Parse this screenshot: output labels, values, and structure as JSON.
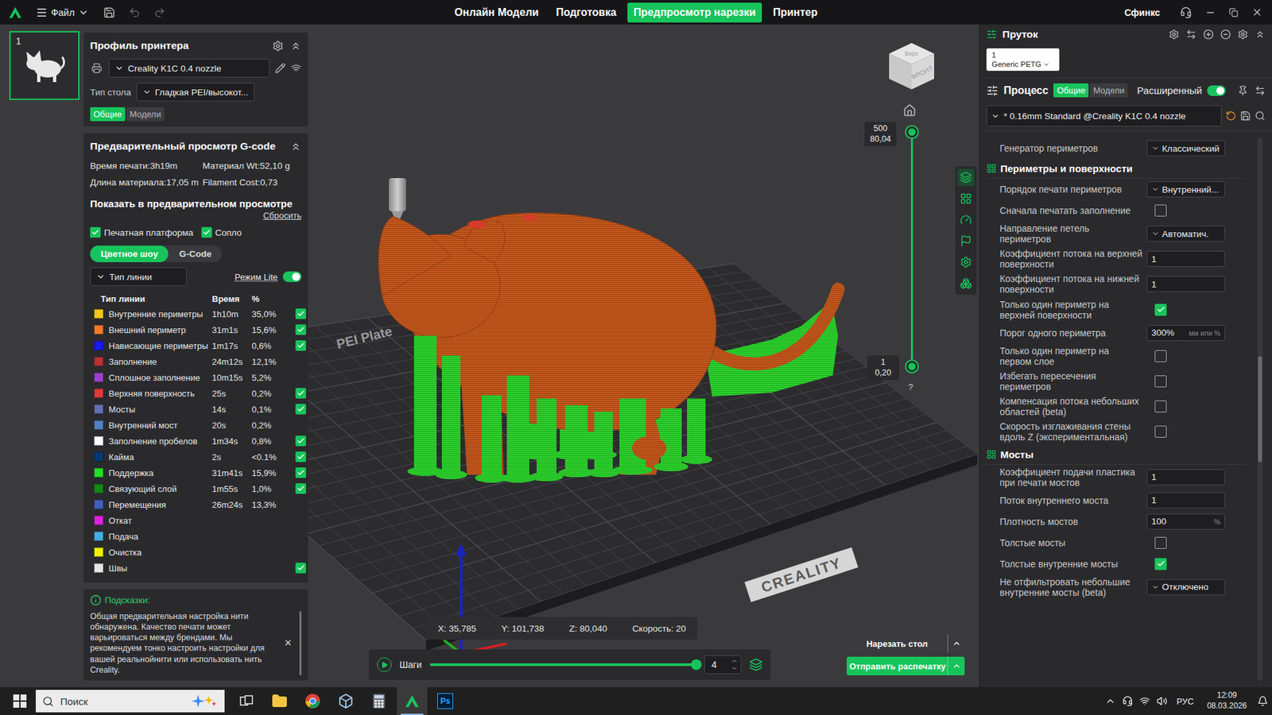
{
  "app": {
    "menu": "Файл",
    "user": "Сфинкс"
  },
  "topTabs": [
    {
      "label": "Онлайн Модели",
      "selected": false
    },
    {
      "label": "Подготовка",
      "selected": false
    },
    {
      "label": "Предпросмотр нарезки",
      "selected": true
    },
    {
      "label": "Принтер",
      "selected": false
    }
  ],
  "plates": [
    {
      "number": "1",
      "selected": true
    }
  ],
  "printerProfile": {
    "title": "Профиль принтера",
    "printer": "Creality K1C 0.4 nozzle",
    "bedLabel": "Тип стола",
    "bed": "Гладкая PEI/высокот...",
    "tabs": [
      {
        "label": "Общие",
        "selected": true
      },
      {
        "label": "Модели",
        "selected": false
      }
    ]
  },
  "gcodePreview": {
    "title": "Предварительный просмотр G-code",
    "stats": [
      "Время печати:3h19m",
      "Материал Wt:52,10 g",
      "Длина материала:17,05 m",
      "Filament Cost:0,73"
    ]
  },
  "display": {
    "title": "Показать в предварительном просмотре",
    "reset": "Сбросить",
    "options": [
      {
        "label": "Печатная платформа",
        "checked": true
      },
      {
        "label": "Сопло",
        "checked": true
      }
    ],
    "modes": [
      {
        "label": "Цветное шоу",
        "selected": true
      },
      {
        "label": "G-Code",
        "selected": false
      }
    ],
    "viewType": "Тип линии",
    "liteMode": {
      "label": "Режим Lite",
      "on": true
    },
    "columns": [
      "Тип линии",
      "Время",
      "%"
    ],
    "lines": [
      {
        "name": "Внутренние периметры",
        "time": "1h10m",
        "percent": "35,0%",
        "checked": true,
        "color": "#f5c518"
      },
      {
        "name": "Внешний периметр",
        "time": "31m1s",
        "percent": "15,6%",
        "checked": true,
        "color": "#f07a2a"
      },
      {
        "name": "Нависающие периметры",
        "time": "1m17s",
        "percent": "0,6%",
        "checked": true,
        "color": "#1a1aff"
      },
      {
        "name": "Заполнение",
        "time": "24m12s",
        "percent": "12,1%",
        "checked": false,
        "color": "#b83232"
      },
      {
        "name": "Сплошное заполнение",
        "time": "10m15s",
        "percent": "5,2%",
        "checked": false,
        "color": "#a040d0"
      },
      {
        "name": "Верхняя поверхность",
        "time": "25s",
        "percent": "0,2%",
        "checked": true,
        "color": "#e03a3a"
      },
      {
        "name": "Мосты",
        "time": "14s",
        "percent": "0,1%",
        "checked": true,
        "color": "#6070b0"
      },
      {
        "name": "Внутренний мост",
        "time": "20s",
        "percent": "0,2%",
        "checked": false,
        "color": "#4f82c4"
      },
      {
        "name": "Заполнение пробелов",
        "time": "1m34s",
        "percent": "0,8%",
        "checked": true,
        "color": "#ffffff"
      },
      {
        "name": "Кайма",
        "time": "2s",
        "percent": "<0.1%",
        "checked": true,
        "color": "#003a78"
      },
      {
        "name": "Поддержка",
        "time": "31m41s",
        "percent": "15,9%",
        "checked": true,
        "color": "#22e022"
      },
      {
        "name": "Связующий слой",
        "time": "1m55s",
        "percent": "1,0%",
        "checked": true,
        "color": "#108a10"
      },
      {
        "name": "Перемещения",
        "time": "26m24s",
        "percent": "13,3%",
        "checked": false,
        "color": "#4060c0"
      },
      {
        "name": "Откат",
        "time": "",
        "percent": "",
        "checked": false,
        "color": "#e020e0"
      },
      {
        "name": "Подача",
        "time": "",
        "percent": "",
        "checked": false,
        "color": "#40b0e0"
      },
      {
        "name": "Очистка",
        "time": "",
        "percent": "",
        "checked": false,
        "color": "#f0f000"
      },
      {
        "name": "Швы",
        "time": "",
        "percent": "",
        "checked": true,
        "color": "#e6e6e6"
      }
    ]
  },
  "hint": {
    "title": "Подсказки:",
    "text": "Общая предварительная настройка нити обнаружена. Качество печати может варьироваться между брендами. Мы рекомендуем тонко настроить настройки для вашей реальнойнити или использовать нить Creality.",
    "close": "×"
  },
  "viewport": {
    "cube": [
      "Верх",
      "ФРОНТ"
    ],
    "bedLabels": [
      "PEI Plate",
      "CREALITY"
    ],
    "layers": {
      "top": "500",
      "topHeight": "80,04",
      "bottom": "1",
      "bottomHeight": "0,20",
      "help": "?",
      "upperLevel": 1,
      "lowerLevel": 0
    },
    "tools": [
      {
        "selected": true
      },
      {
        "selected": false
      },
      {
        "selected": false
      },
      {
        "selected": false
      },
      {
        "selected": false
      },
      {
        "selected": false
      }
    ],
    "coords": [
      "X: 35,785",
      "Y: 101,738",
      "Z: 80,040",
      "Скорость: 20"
    ],
    "steps": {
      "label": "Шаги",
      "value": "4",
      "level": 1
    },
    "actions": [
      {
        "label": "Нарезать стол",
        "primary": false
      },
      {
        "label": "Отправить распечатку",
        "primary": true
      }
    ]
  },
  "filament": {
    "title": "Пруток",
    "slots": [
      {
        "number": "1",
        "name": "Generic PETG"
      }
    ]
  },
  "process": {
    "title": "Процесс",
    "tabs": [
      {
        "label": "Общие",
        "selected": true
      },
      {
        "label": "Модели",
        "selected": false
      }
    ],
    "advanced": {
      "label": "Расширенный",
      "on": true
    },
    "profile": "* 0.16mm Standard @Creality K1C 0.4 nozzle"
  },
  "settings": [
    {
      "kind": "select",
      "label": "Генератор периметров",
      "value": "Классический"
    },
    {
      "kind": "section",
      "label": "Периметры и поверхности"
    },
    {
      "kind": "select",
      "label": "Порядок печати периметров",
      "value": "Внутренний..."
    },
    {
      "kind": "checkbox",
      "label": "Сначала печатать заполнение",
      "checked": false
    },
    {
      "kind": "select",
      "label": "Направление петель периметров",
      "value": "Автоматич."
    },
    {
      "kind": "number",
      "label": "Коэффициент потока на верхней поверхности",
      "value": "1"
    },
    {
      "kind": "number",
      "label": "Коэффициент потока на нижней поверхности",
      "value": "1"
    },
    {
      "kind": "checkbox",
      "label": "Только один периметр на верхней поверхности",
      "checked": true
    },
    {
      "kind": "number",
      "label": "Порог одного периметра",
      "value": "300%",
      "unit": "мм или %"
    },
    {
      "kind": "checkbox",
      "label": "Только один периметр на первом слое",
      "checked": false
    },
    {
      "kind": "checkbox",
      "label": "Избегать пересечения периметров",
      "checked": false
    },
    {
      "kind": "checkbox",
      "label": "Компенсация потока небольших областей (beta)",
      "checked": false
    },
    {
      "kind": "checkbox",
      "label": "Скорость изглаживания стены вдоль Z (экспериментальная)",
      "checked": false
    },
    {
      "kind": "section",
      "label": "Мосты"
    },
    {
      "kind": "number",
      "label": "Коэффициент подачи пластика при печати мостов",
      "value": "1"
    },
    {
      "kind": "number",
      "label": "Поток внутреннего моста",
      "value": "1"
    },
    {
      "kind": "number",
      "label": "Плотность мостов",
      "value": "100",
      "unit": "%"
    },
    {
      "kind": "checkbox",
      "label": "Толстые мосты",
      "checked": false
    },
    {
      "kind": "checkbox",
      "label": "Толстые внутренние мосты",
      "checked": true
    },
    {
      "kind": "select",
      "label": "Не отфильтровать небольшие внутренние мосты (beta)",
      "value": "Отключено"
    }
  ],
  "taskbar": {
    "search": "Поиск",
    "apps": [
      {
        "kind": "taskview",
        "active": false
      },
      {
        "kind": "explorer",
        "active": false
      },
      {
        "kind": "chrome",
        "active": false
      },
      {
        "kind": "store",
        "active": false
      },
      {
        "kind": "calculator",
        "active": false
      },
      {
        "kind": "creality",
        "active": true
      },
      {
        "kind": "photoshop",
        "active": false,
        "label": "Ps"
      }
    ],
    "language": "РУС",
    "time": "12:09",
    "date": "08.03.2026"
  }
}
